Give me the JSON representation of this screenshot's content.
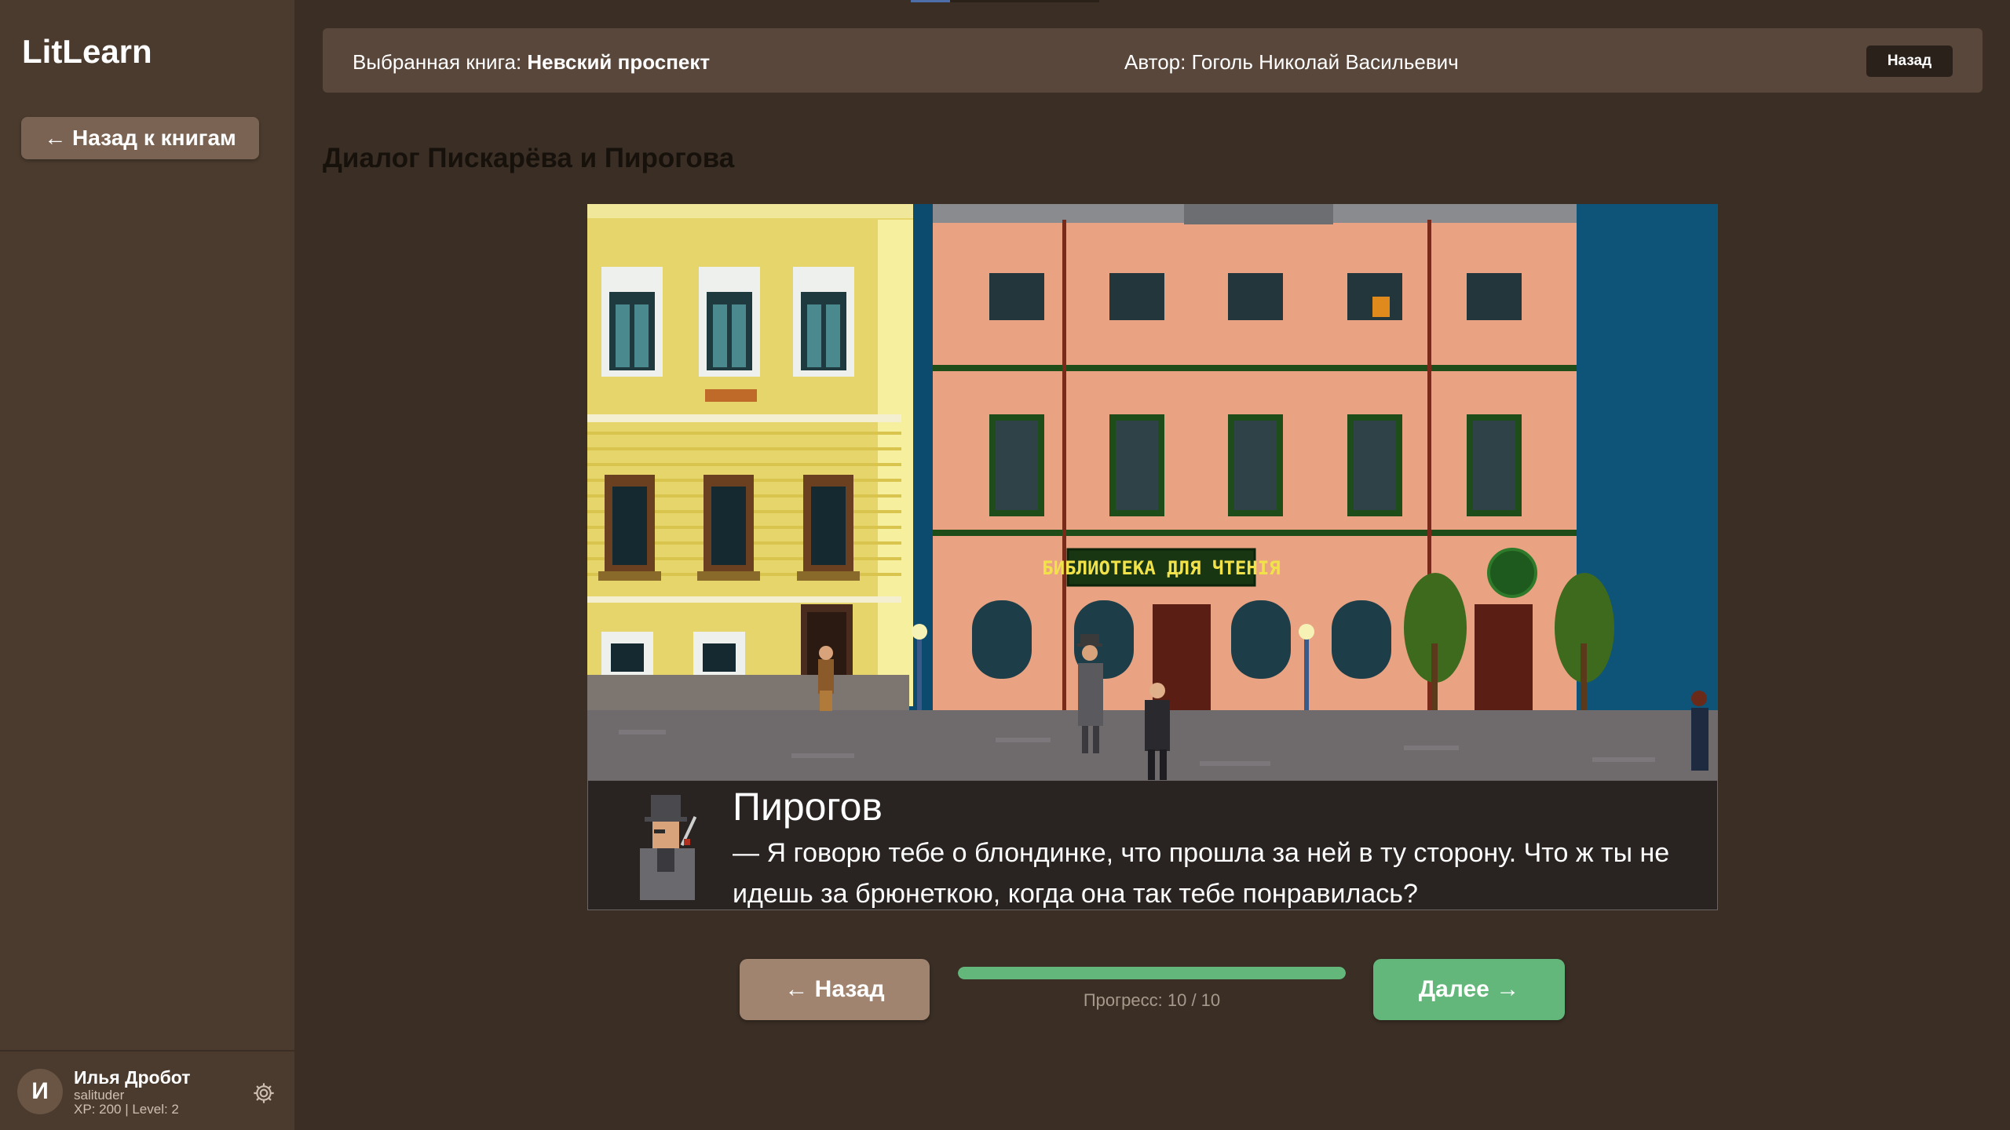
{
  "app": {
    "logo": "LitLearn"
  },
  "sidebar": {
    "back_button": "← Назад к книгам",
    "user": {
      "initial": "И",
      "name": "Илья Дробот",
      "login": "salituder",
      "stats": "XP: 200 | Level: 2"
    },
    "settings_icon": "gear-icon"
  },
  "header": {
    "book_label": "Выбранная книга: ",
    "book_title": "Невский проспект",
    "author": "Автор: Гоголь Николай Васильевич",
    "back_label": "Назад"
  },
  "scene": {
    "title": "Диалог Пискарёва и Пирогова",
    "sign": "БИБЛИОТЕКА ДЛЯ ЧТЕНІЯ",
    "speaker": "Пирогов",
    "line": "— Я говорю тебе о блондинке, что прошла за ней в ту сторону. Что ж ты не идешь за брюнеткою, когда она так тебе понравилась?"
  },
  "controls": {
    "prev_label": "← Назад",
    "next_label": "Далее →",
    "progress_text": "Прогресс: 10 / 10",
    "progress_fraction": 1.0
  },
  "colors": {
    "accent_green": "#64b77b",
    "sidebar_bg": "#4b3b2e",
    "page_bg": "#3a2e25"
  }
}
